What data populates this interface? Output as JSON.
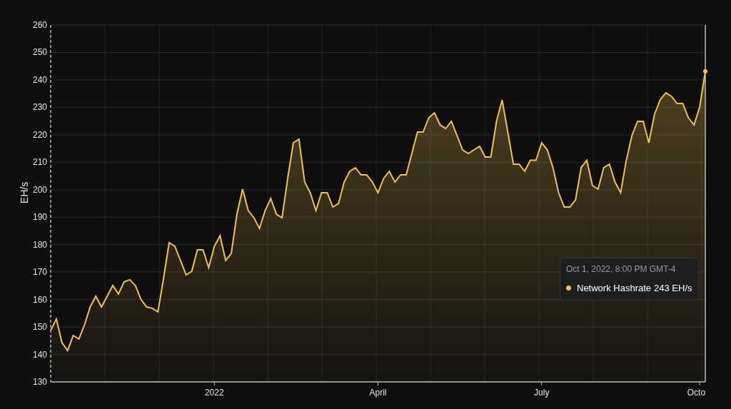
{
  "chart_data": {
    "type": "area",
    "ylabel": "EH/s",
    "grid": true,
    "ylim": [
      130,
      260
    ],
    "yticks": [
      130,
      140,
      150,
      160,
      170,
      180,
      190,
      200,
      210,
      220,
      230,
      240,
      250,
      260
    ],
    "categories": [
      null,
      null,
      null,
      null,
      null,
      null,
      null,
      null,
      null,
      null,
      null,
      null,
      null,
      null,
      null,
      null,
      null,
      null,
      null,
      null,
      null,
      null,
      null,
      null,
      null,
      null,
      null,
      null,
      null,
      "2022",
      null,
      null,
      null,
      null,
      null,
      null,
      null,
      null,
      null,
      null,
      null,
      null,
      null,
      null,
      null,
      null,
      null,
      null,
      null,
      null,
      null,
      null,
      null,
      null,
      null,
      null,
      null,
      null,
      "April",
      null,
      null,
      null,
      null,
      null,
      null,
      null,
      null,
      null,
      null,
      null,
      null,
      null,
      null,
      null,
      null,
      null,
      null,
      null,
      null,
      null,
      null,
      null,
      null,
      null,
      null,
      null,
      null,
      "July",
      null,
      null,
      null,
      null,
      null,
      null,
      null,
      null,
      null,
      null,
      null,
      null,
      null,
      null,
      null,
      null,
      null,
      null,
      null,
      null,
      null,
      null,
      null,
      null,
      null,
      null,
      null,
      "Octo",
      null
    ],
    "series": [
      {
        "name": "Network Hashrate",
        "color": "#f2c14e",
        "values": [
          148.7,
          152.9,
          144.3,
          141.4,
          146.9,
          145.6,
          150.8,
          157.3,
          161.2,
          157.3,
          161.2,
          165.1,
          162,
          166.4,
          167.2,
          165.1,
          160,
          157.3,
          156.8,
          155.5,
          167.7,
          180.7,
          179.4,
          174.2,
          169,
          170.3,
          178.1,
          178.1,
          171.6,
          179.4,
          183.3,
          174.2,
          176.8,
          191.1,
          200.2,
          192.4,
          189.8,
          185.9,
          192.4,
          196.8,
          191.1,
          189.8,
          204.1,
          217.1,
          218.4,
          202.8,
          198.9,
          192.4,
          198.9,
          198.9,
          193.7,
          195,
          202.8,
          206.7,
          208,
          205.4,
          205.4,
          202.8,
          198.9,
          204.1,
          206.7,
          202.8,
          205.4,
          205.4,
          213.2,
          221,
          221,
          226.2,
          228,
          223.6,
          222.3,
          224.9,
          219.7,
          214.5,
          213.2,
          214.5,
          215.8,
          211.9,
          211.9,
          224.9,
          232.7,
          221,
          209.3,
          209.3,
          206.7,
          210.7,
          210.7,
          217.1,
          214.5,
          208,
          198.9,
          193.7,
          193.7,
          196.3,
          208,
          210.7,
          201.5,
          200.2,
          208,
          209.3,
          202.8,
          198.9,
          210.7,
          219.7,
          224.9,
          224.9,
          217.1,
          227.5,
          232.7,
          235.3,
          234,
          231.4,
          231.4,
          226.2,
          223.6,
          230.1,
          243.1
        ]
      }
    ]
  },
  "tooltip": {
    "date": "Oct 1, 2022, 8:00 PM GMT-4",
    "value": "243 EH/s"
  }
}
